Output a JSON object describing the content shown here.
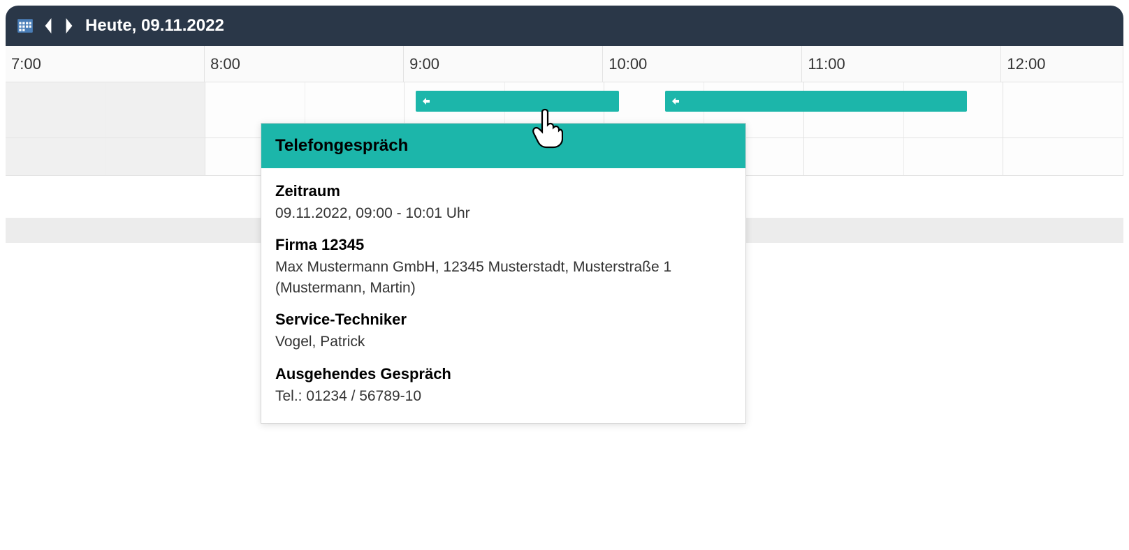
{
  "header": {
    "title": "Heute, 09.11.2022"
  },
  "timeline": {
    "hours": [
      "7:00",
      "8:00",
      "9:00",
      "10:00",
      "11:00",
      "12:00"
    ]
  },
  "events": [
    {
      "id": "event-1",
      "start_pct": 36.7,
      "width_pct": 18.2
    },
    {
      "id": "event-2",
      "start_pct": 59.0,
      "width_pct": 27.0
    }
  ],
  "tooltip": {
    "title": "Telefongespräch",
    "zeitraum_label": "Zeitraum",
    "zeitraum_value": "09.11.2022, 09:00 - 10:01 Uhr",
    "firma_label": "Firma 12345",
    "firma_value": "Max Mustermann GmbH, 12345 Musterstadt, Musterstraße 1 (Mustermann, Martin)",
    "techniker_label": "Service-Techniker",
    "techniker_value": "Vogel, Patrick",
    "ausgehend_label": "Ausgehendes Gespräch",
    "ausgehend_value": "Tel.: 01234 / 56789-10"
  }
}
